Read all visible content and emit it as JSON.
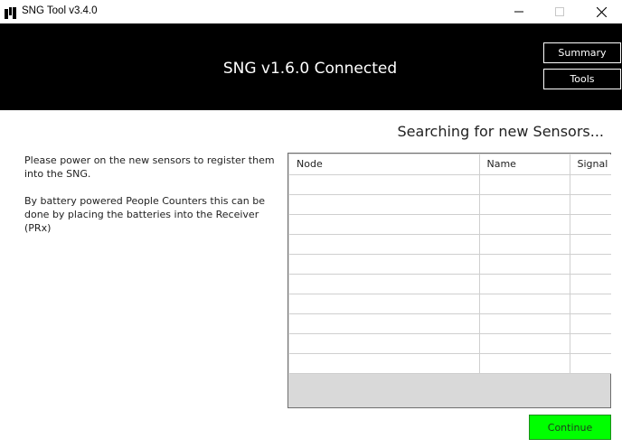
{
  "window": {
    "title": "SNG Tool v3.4.0"
  },
  "header": {
    "status": "SNG v1.6.0 Connected",
    "summary_label": "Summary",
    "tools_label": "Tools"
  },
  "main": {
    "search_status": "Searching for new Sensors...",
    "instructions": [
      "Please power on the new sensors to register them into the SNG.",
      "By battery powered People Counters this can be done by placing the batteries into the Receiver (PRx)"
    ],
    "table": {
      "columns": [
        "Node",
        "Name",
        "Signal"
      ],
      "rows": [
        [
          "",
          "",
          ""
        ],
        [
          "",
          "",
          ""
        ],
        [
          "",
          "",
          ""
        ],
        [
          "",
          "",
          ""
        ],
        [
          "",
          "",
          ""
        ],
        [
          "",
          "",
          ""
        ],
        [
          "",
          "",
          ""
        ],
        [
          "",
          "",
          ""
        ],
        [
          "",
          "",
          ""
        ],
        [
          "",
          "",
          ""
        ]
      ]
    },
    "continue_label": "Continue"
  },
  "colors": {
    "header_bg": "#000000",
    "continue_bg": "#00ff00",
    "table_footer": "#d9d9d9"
  }
}
